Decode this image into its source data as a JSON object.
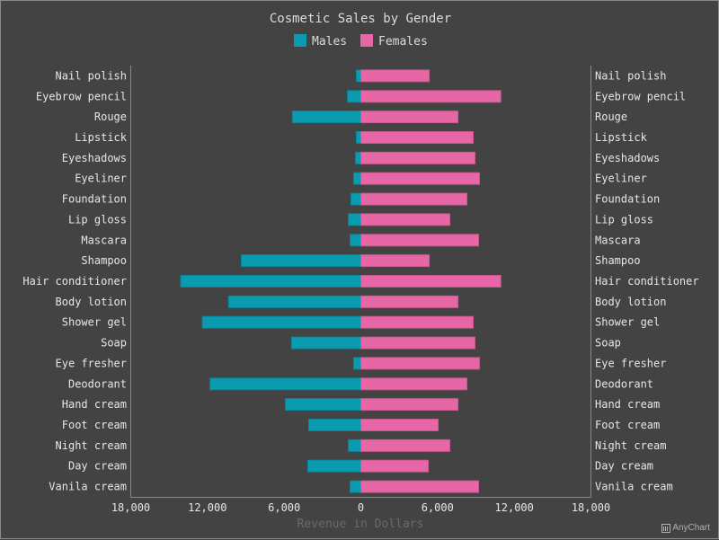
{
  "chart_data": {
    "type": "bar",
    "orientation": "horizontal",
    "style": "tornado",
    "title": "Cosmetic Sales by Gender",
    "xlabel": "Revenue in Dollars",
    "ylabel": "",
    "xlim": [
      -18000,
      18000
    ],
    "ticks": [
      -18000,
      -12000,
      -6000,
      0,
      6000,
      12000,
      18000
    ],
    "tick_labels": [
      "18,000",
      "12,000",
      "6,000",
      "0",
      "6,000",
      "12,000",
      "18,000"
    ],
    "legend_position": "top",
    "grid": false,
    "categories": [
      "Nail polish",
      "Eyebrow pencil",
      "Rouge",
      "Lipstick",
      "Eyeshadows",
      "Eyeliner",
      "Foundation",
      "Lip gloss",
      "Mascara",
      "Shampoo",
      "Hair conditioner",
      "Body lotion",
      "Shower gel",
      "Soap",
      "Eye fresher",
      "Deodorant",
      "Hand cream",
      "Foot cream",
      "Night cream",
      "Day cream",
      "Vanila cream"
    ],
    "series": [
      {
        "name": "Males",
        "color": "#0b9bb0",
        "direction": "left",
        "values": [
          350,
          1050,
          5350,
          350,
          420,
          560,
          770,
          980,
          840,
          9350,
          14100,
          10350,
          12400,
          5420,
          560,
          11800,
          5900,
          4080,
          980,
          4150,
          840
        ]
      },
      {
        "name": "Females",
        "color": "#e766a5",
        "direction": "right",
        "values": [
          5350,
          10950,
          7600,
          8790,
          8930,
          9280,
          8300,
          6960,
          9210,
          5350,
          10950,
          7600,
          8790,
          8930,
          9280,
          8300,
          7600,
          6050,
          6960,
          5280,
          9210
        ]
      }
    ]
  },
  "credits": {
    "label": "AnyChart"
  }
}
